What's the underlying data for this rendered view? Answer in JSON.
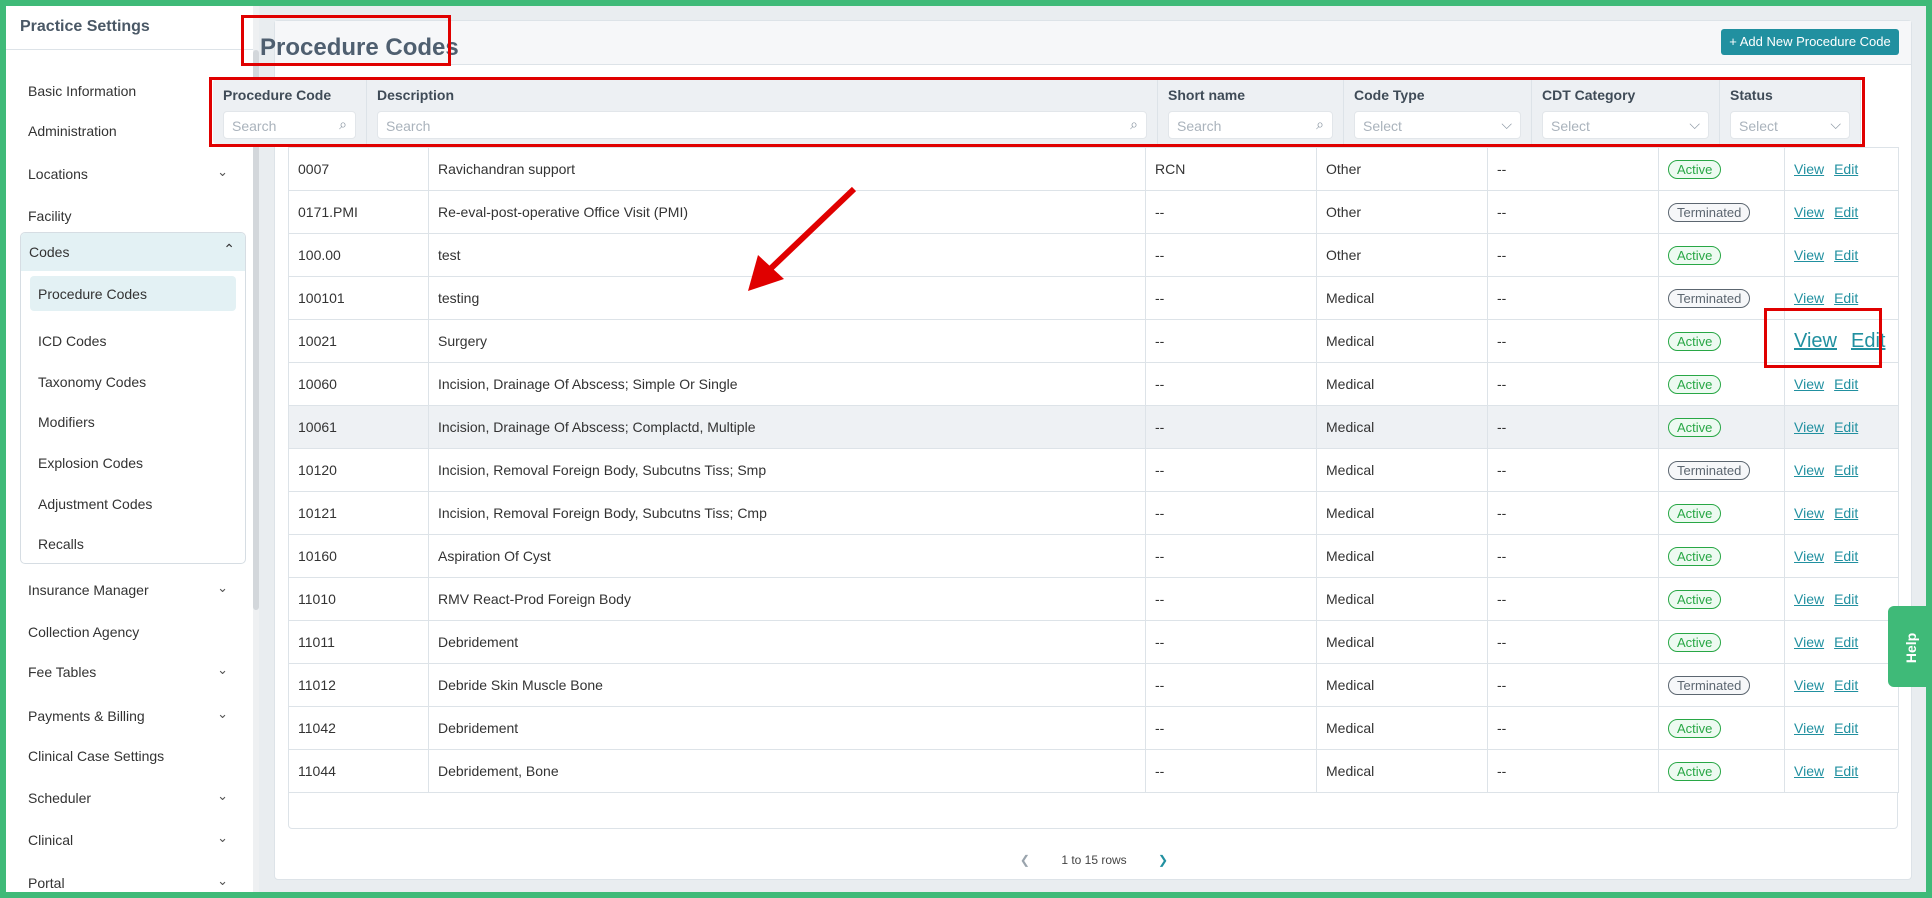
{
  "sidebar": {
    "title": "Practice Settings",
    "items": [
      {
        "label": "Basic Information",
        "chev": false
      },
      {
        "label": "Administration",
        "chev": false
      },
      {
        "label": "Locations",
        "chev": true
      },
      {
        "label": "Facility",
        "chev": false
      }
    ],
    "codes": {
      "label": "Codes",
      "children": [
        "Procedure Codes",
        "ICD Codes",
        "Taxonomy Codes",
        "Modifiers",
        "Explosion Codes",
        "Adjustment Codes",
        "Recalls"
      ],
      "active": "Procedure Codes"
    },
    "items2": [
      {
        "label": "Insurance Manager",
        "chev": true
      },
      {
        "label": "Collection Agency",
        "chev": false
      },
      {
        "label": "Fee Tables",
        "chev": true
      },
      {
        "label": "Payments & Billing",
        "chev": true
      },
      {
        "label": "Clinical Case Settings",
        "chev": false
      },
      {
        "label": "Scheduler",
        "chev": true
      },
      {
        "label": "Clinical",
        "chev": true
      },
      {
        "label": "Portal",
        "chev": true
      }
    ]
  },
  "page": {
    "title": "Procedure Codes",
    "add_label": "+ Add New Procedure Code"
  },
  "filters": [
    {
      "label": "Procedure Code",
      "placeholder": "Search",
      "type": "search"
    },
    {
      "label": "Description",
      "placeholder": "Search",
      "type": "search"
    },
    {
      "label": "Short name",
      "placeholder": "Search",
      "type": "search"
    },
    {
      "label": "Code Type",
      "placeholder": "Select",
      "type": "select"
    },
    {
      "label": "CDT Category",
      "placeholder": "Select",
      "type": "select"
    },
    {
      "label": "Status",
      "placeholder": "Select",
      "type": "select"
    }
  ],
  "actions": {
    "view": "View",
    "edit": "Edit"
  },
  "rows": [
    [
      "0007",
      "Ravichandran support",
      "RCN",
      "Other",
      "--",
      "Active"
    ],
    [
      "0171.PMI",
      "Re-eval-post-operative Office Visit (PMI)",
      "--",
      "Other",
      "--",
      "Terminated"
    ],
    [
      "100.00",
      "test",
      "--",
      "Other",
      "--",
      "Active"
    ],
    [
      "100101",
      "testing",
      "--",
      "Medical",
      "--",
      "Terminated"
    ],
    [
      "10021",
      "Surgery",
      "--",
      "Medical",
      "--",
      "Active"
    ],
    [
      "10060",
      "Incision, Drainage Of Abscess; Simple Or Single",
      "--",
      "Medical",
      "--",
      "Active"
    ],
    [
      "10061",
      "Incision, Drainage Of Abscess; Complactd, Multiple",
      "--",
      "Medical",
      "--",
      "Active"
    ],
    [
      "10120",
      "Incision, Removal Foreign Body, Subcutns Tiss; Smp",
      "--",
      "Medical",
      "--",
      "Terminated"
    ],
    [
      "10121",
      "Incision, Removal Foreign Body, Subcutns Tiss; Cmp",
      "--",
      "Medical",
      "--",
      "Active"
    ],
    [
      "10160",
      "Aspiration Of Cyst",
      "--",
      "Medical",
      "--",
      "Active"
    ],
    [
      "11010",
      "RMV React-Prod Foreign Body",
      "--",
      "Medical",
      "--",
      "Active"
    ],
    [
      "11011",
      "Debridement",
      "--",
      "Medical",
      "--",
      "Active"
    ],
    [
      "11012",
      "Debride Skin Muscle Bone",
      "--",
      "Medical",
      "--",
      "Terminated"
    ],
    [
      "11042",
      "Debridement",
      "--",
      "Medical",
      "--",
      "Active"
    ],
    [
      "11044",
      "Debridement, Bone",
      "--",
      "Medical",
      "--",
      "Active"
    ]
  ],
  "pager": {
    "text": "1 to 15 rows"
  },
  "help": "Help",
  "colors": {
    "accent": "#2190a0",
    "active": "#28a745",
    "frame": "#3fba78",
    "annotation": "#e00000"
  }
}
